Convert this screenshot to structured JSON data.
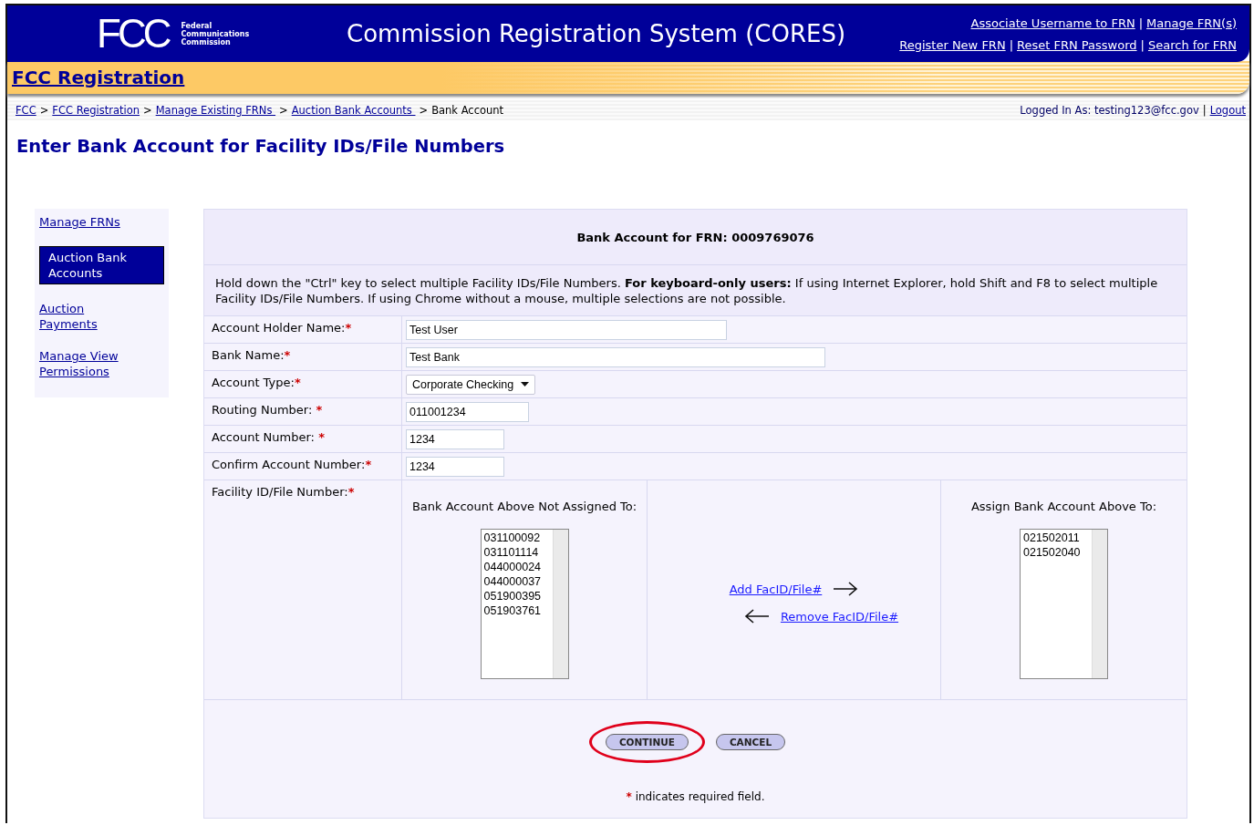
{
  "header": {
    "logo_mark": "FCC",
    "logo_lines": [
      "Federal",
      "Communications",
      "Commission"
    ],
    "title": "Commission Registration System (CORES)",
    "separator": "|",
    "link_rows": [
      [
        "Associate Username to FRN",
        "Manage FRN(s)"
      ],
      [
        "Register New FRN",
        "Reset FRN Password",
        "Search for FRN"
      ]
    ]
  },
  "banner": {
    "title": "FCC Registration"
  },
  "breadcrumb": {
    "separator": ">",
    "links": [
      "FCC",
      "FCC Registration",
      "Manage Existing FRNs ",
      "Auction Bank Accounts "
    ],
    "current": "Bank Account",
    "logged_in": "Logged In As: testing123@fcc.gov",
    "divider": "|",
    "logout": "Logout"
  },
  "page_title": "Enter Bank Account for Facility IDs/File Numbers",
  "sidebar": {
    "items": [
      {
        "label": "Manage FRNs",
        "selected": false
      },
      {
        "label": "Auction Bank Accounts",
        "selected": true
      },
      {
        "label": "Auction Payments",
        "selected": false
      },
      {
        "label": "Manage View Permissions",
        "selected": false
      }
    ]
  },
  "form": {
    "heading": "Bank Account for FRN: 0009769076",
    "instructions": "Hold down the \"Ctrl\" key to select multiple Facility IDs/File Numbers. **For keyboard-only users:** If using Internet Explorer, hold Shift and F8 to select multiple Facility IDs/File Numbers. If using Chrome without a mouse, multiple selections are not possible.",
    "required_mark": "*",
    "fields": [
      {
        "label": "Account Holder Name:",
        "kind": "text",
        "value": "Test User"
      },
      {
        "label": "Bank Name:",
        "kind": "text",
        "value": "Test Bank"
      },
      {
        "label": "Account Type:",
        "kind": "select",
        "value": "Corporate Checking"
      },
      {
        "label": "Routing Number: ",
        "kind": "text",
        "value": "011001234"
      },
      {
        "label": "Account Number: ",
        "kind": "text",
        "value": "1234"
      },
      {
        "label": "Confirm Account Number:",
        "kind": "text",
        "value": "1234"
      }
    ],
    "facility": {
      "label": "Facility ID/File Number:",
      "unassigned": {
        "title": "Bank Account Above Not Assigned To:",
        "items": [
          "031100092",
          "031101114",
          "044000024",
          "044000037",
          "051900395",
          "051903761"
        ]
      },
      "add_link": "Add FacID/File#",
      "remove_link": "Remove FacID/File#",
      "assigned": {
        "title": "Assign Bank Account Above To:",
        "items": [
          "021502011",
          "021502040"
        ]
      }
    },
    "buttons": [
      {
        "label": "CONTINUE",
        "circled": true
      },
      {
        "label": "CANCEL",
        "circled": false
      }
    ],
    "note": "indicates required field."
  }
}
